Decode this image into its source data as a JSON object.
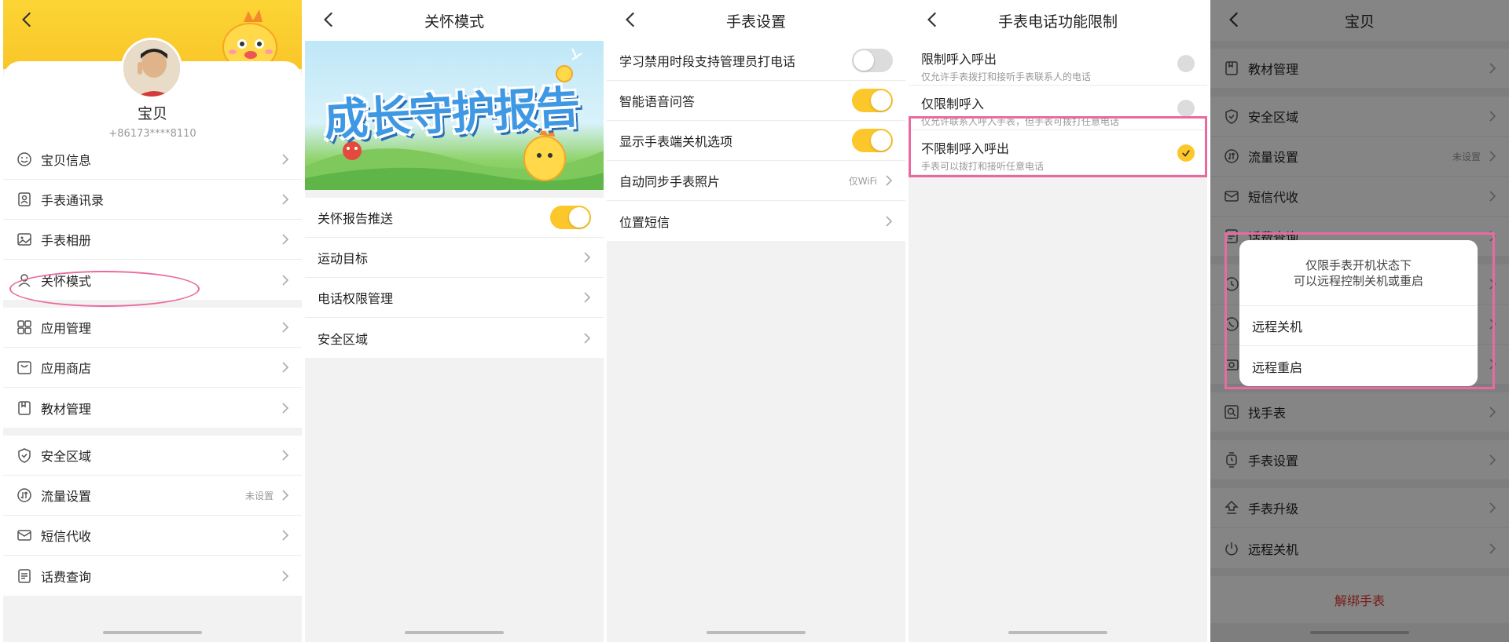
{
  "panel1": {
    "name": "宝贝",
    "phone": "+86173****8110",
    "groups": [
      [
        {
          "label": "宝贝信息",
          "icon": "smile-icon"
        },
        {
          "label": "手表通讯录",
          "icon": "contacts-icon"
        },
        {
          "label": "手表相册",
          "icon": "image-icon"
        },
        {
          "label": "关怀模式",
          "icon": "person-icon"
        }
      ],
      [
        {
          "label": "应用管理",
          "icon": "grid-icon"
        },
        {
          "label": "应用商店",
          "icon": "bag-icon"
        },
        {
          "label": "教材管理",
          "icon": "book-icon"
        }
      ],
      [
        {
          "label": "安全区域",
          "icon": "shield-icon"
        },
        {
          "label": "流量设置",
          "icon": "data-icon",
          "hint": "未设置"
        },
        {
          "label": "短信代收",
          "icon": "mail-icon"
        },
        {
          "label": "话费查询",
          "icon": "bill-icon"
        }
      ]
    ]
  },
  "panel2": {
    "title": "关怀模式",
    "banner_text": "成长守护报告",
    "items": [
      {
        "label": "关怀报告推送",
        "toggle": true
      },
      {
        "label": "运动目标"
      },
      {
        "label": "电话权限管理"
      },
      {
        "label": "安全区域"
      }
    ]
  },
  "panel3": {
    "title": "手表设置",
    "items": [
      {
        "label": "学习禁用时段支持管理员打电话",
        "toggle": false
      },
      {
        "label": "智能语音问答",
        "toggle": true
      },
      {
        "label": "显示手表端关机选项",
        "toggle": true
      },
      {
        "label": "自动同步手表照片",
        "hint": "仅WiFi"
      },
      {
        "label": "位置短信"
      }
    ]
  },
  "panel4": {
    "title": "手表电话功能限制",
    "options": [
      {
        "title": "限制呼入呼出",
        "subtitle": "仅允许手表拨打和接听手表联系人的电话",
        "selected": false
      },
      {
        "title": "仅限制呼入",
        "subtitle": "仅允许联系人呼入手表，但手表可拨打任意电话",
        "selected": false
      },
      {
        "title": "不限制呼入呼出",
        "subtitle": "手表可以拨打和接听任意电话",
        "selected": true
      }
    ]
  },
  "panel5": {
    "title": "宝贝",
    "rows": [
      {
        "label": "教材管理",
        "icon": "book-icon",
        "gap_after": true
      },
      {
        "label": "安全区域",
        "icon": "shield-icon"
      },
      {
        "label": "流量设置",
        "icon": "data-icon",
        "hint": "未设置"
      },
      {
        "label": "短信代收",
        "icon": "mail-icon"
      },
      {
        "label": "话费查询",
        "icon": "bill-icon",
        "gap_after": true
      },
      {
        "label": "",
        "icon": "clock-icon"
      },
      {
        "label": "",
        "icon": "phone-icon"
      },
      {
        "label": "",
        "icon": "camera-icon",
        "gap_after": true
      },
      {
        "label": "找手表",
        "icon": "search-icon",
        "gap_after": true
      },
      {
        "label": "手表设置",
        "icon": "watch-icon",
        "gap_after": true
      },
      {
        "label": "手表升级",
        "icon": "upgrade-icon"
      },
      {
        "label": "远程关机",
        "icon": "power-icon"
      }
    ],
    "modal": {
      "line1": "仅限手表开机状态下",
      "line2": "可以远程控制关机或重启",
      "action1": "远程关机",
      "action2": "远程重启"
    },
    "unbind": "解绑手表"
  },
  "colors": {
    "accent": "#fcc72a",
    "annotation": "#ea6aa0",
    "danger": "#e53935"
  }
}
